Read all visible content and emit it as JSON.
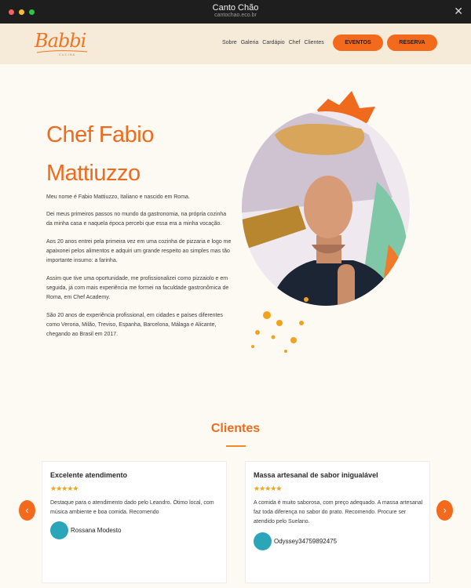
{
  "browser": {
    "title": "Canto Chão",
    "url": "cantochao.eco.br",
    "close_glyph": "✕"
  },
  "header": {
    "logo_text": "Babbi",
    "logo_sub": "CUCINA",
    "nav": [
      "Sobre",
      "Galeria",
      "Cardápio",
      "Chef",
      "Clientes"
    ],
    "btn_eventos": "EVENTOS",
    "btn_reserva": "RESERVA"
  },
  "chef": {
    "title_line1": "Chef Fabio",
    "title_line2": "Mattiuzzo",
    "paragraphs": [
      "Meu nome é Fabio Mattiuzzo, Italiano e nascido em Roma.",
      "Dei meus primeiros passos no mundo da gastronomia, na própria cozinha da minha casa e naquela época percebi que essa era a minha vocação.",
      "Aos 20 anos entrei pela primeira vez em uma cozinha de pizzaria e logo me apaixonei pelos alimentos e adquiri um grande respeito ao simples mas tão importante insumo: a farinha.",
      "Assim que tive uma oportunidade, me profissionalizei como pizzaiolo e em seguida, já com mais experiência me formei na faculdade gastronômica de Roma, em Chef Academy.",
      "São 20 anos de experiência profissional, em cidades e países diferentes como Verona, Milão, Treviso, Espanha, Barcelona, Málaga e Alicante, chegando ao Brasil em 2017."
    ]
  },
  "clients": {
    "title": "Clientes",
    "prev_glyph": "‹",
    "next_glyph": "›",
    "reviews": [
      {
        "title": "Excelente atendimento",
        "stars": "★★★★★",
        "text": "Destaque para o atendimento dado pelo Leandro. Ótimo local, com música ambiente e boa comida. Recomendo",
        "author": "Rossana Modesto"
      },
      {
        "title": "Massa artesanal de sabor inigualável",
        "stars": "★★★★★",
        "text": "A comida é muito saborosa, com preço adequado. A massa artesanal faz toda diferença no sabor do prato. Recomendo. Procure ser atendido pelo Suelano.",
        "author": "Odyssey34759892475"
      }
    ]
  },
  "colors": {
    "accent": "#ee6b1e",
    "button": "#f36a1c",
    "header_bg": "#f6ead8",
    "page_bg": "#fdfaf4",
    "avatar": "#2ba6b8",
    "stars": "#f2a21c"
  }
}
